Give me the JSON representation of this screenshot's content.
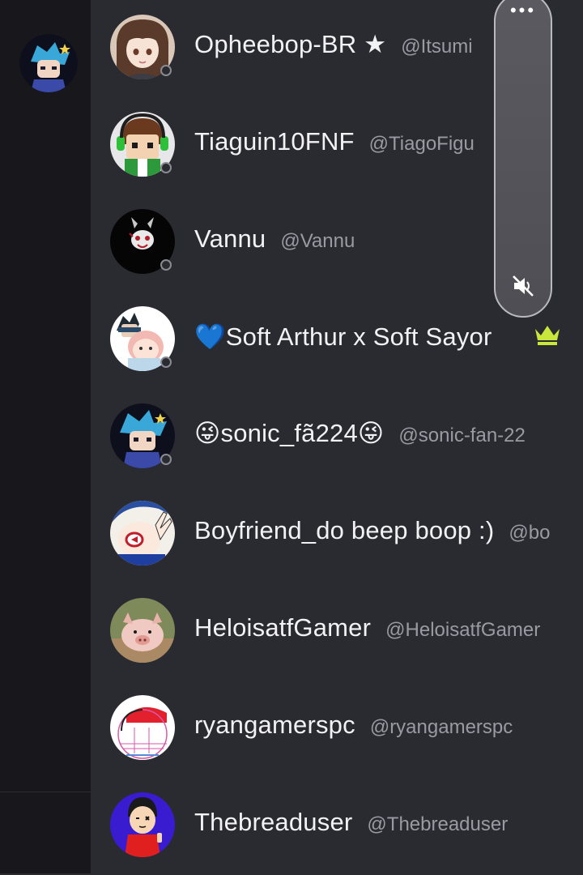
{
  "rail": {
    "avatar_icon": "blue-hair-character-avatar"
  },
  "volume": {
    "menu_dots": "•••",
    "icon": "speaker-muted-icon"
  },
  "members": [
    {
      "name": "Opheebop-BR ★",
      "handle": "@Itsumi",
      "avatar": "anime-girl-avatar",
      "status": "offline"
    },
    {
      "name": "Tiaguin10FNF",
      "handle": "@TiagoFigu",
      "avatar": "gamer-headset-avatar",
      "status": "offline"
    },
    {
      "name": "Vannu",
      "handle": "@Vannu",
      "avatar": "bunny-mask-avatar",
      "status": "offline"
    },
    {
      "name": "💙Soft Arthur x Soft Sayor",
      "handle": "",
      "avatar": "couple-chibi-avatar",
      "status": "offline",
      "badge": "crown-icon",
      "badge_color": "#c8e63c"
    },
    {
      "name": "😜sonic_fã224😜",
      "handle": "@sonic-fan-22",
      "avatar": "blue-hair-character-avatar",
      "status": "offline"
    },
    {
      "name": "Boyfriend_do beep boop :)",
      "handle": "@bo",
      "avatar": "boyfriend-peace-avatar",
      "status": ""
    },
    {
      "name": "HeloisatfGamer",
      "handle": "@HeloisatfGamer",
      "avatar": "piglet-photo-avatar",
      "status": ""
    },
    {
      "name": "ryangamerspc",
      "handle": "@ryangamerspc",
      "avatar": "red-cap-sketch-avatar",
      "status": ""
    },
    {
      "name": "Thebreaduser",
      "handle": "@Thebreaduser",
      "avatar": "red-shirt-cartoon-avatar",
      "status": ""
    }
  ]
}
